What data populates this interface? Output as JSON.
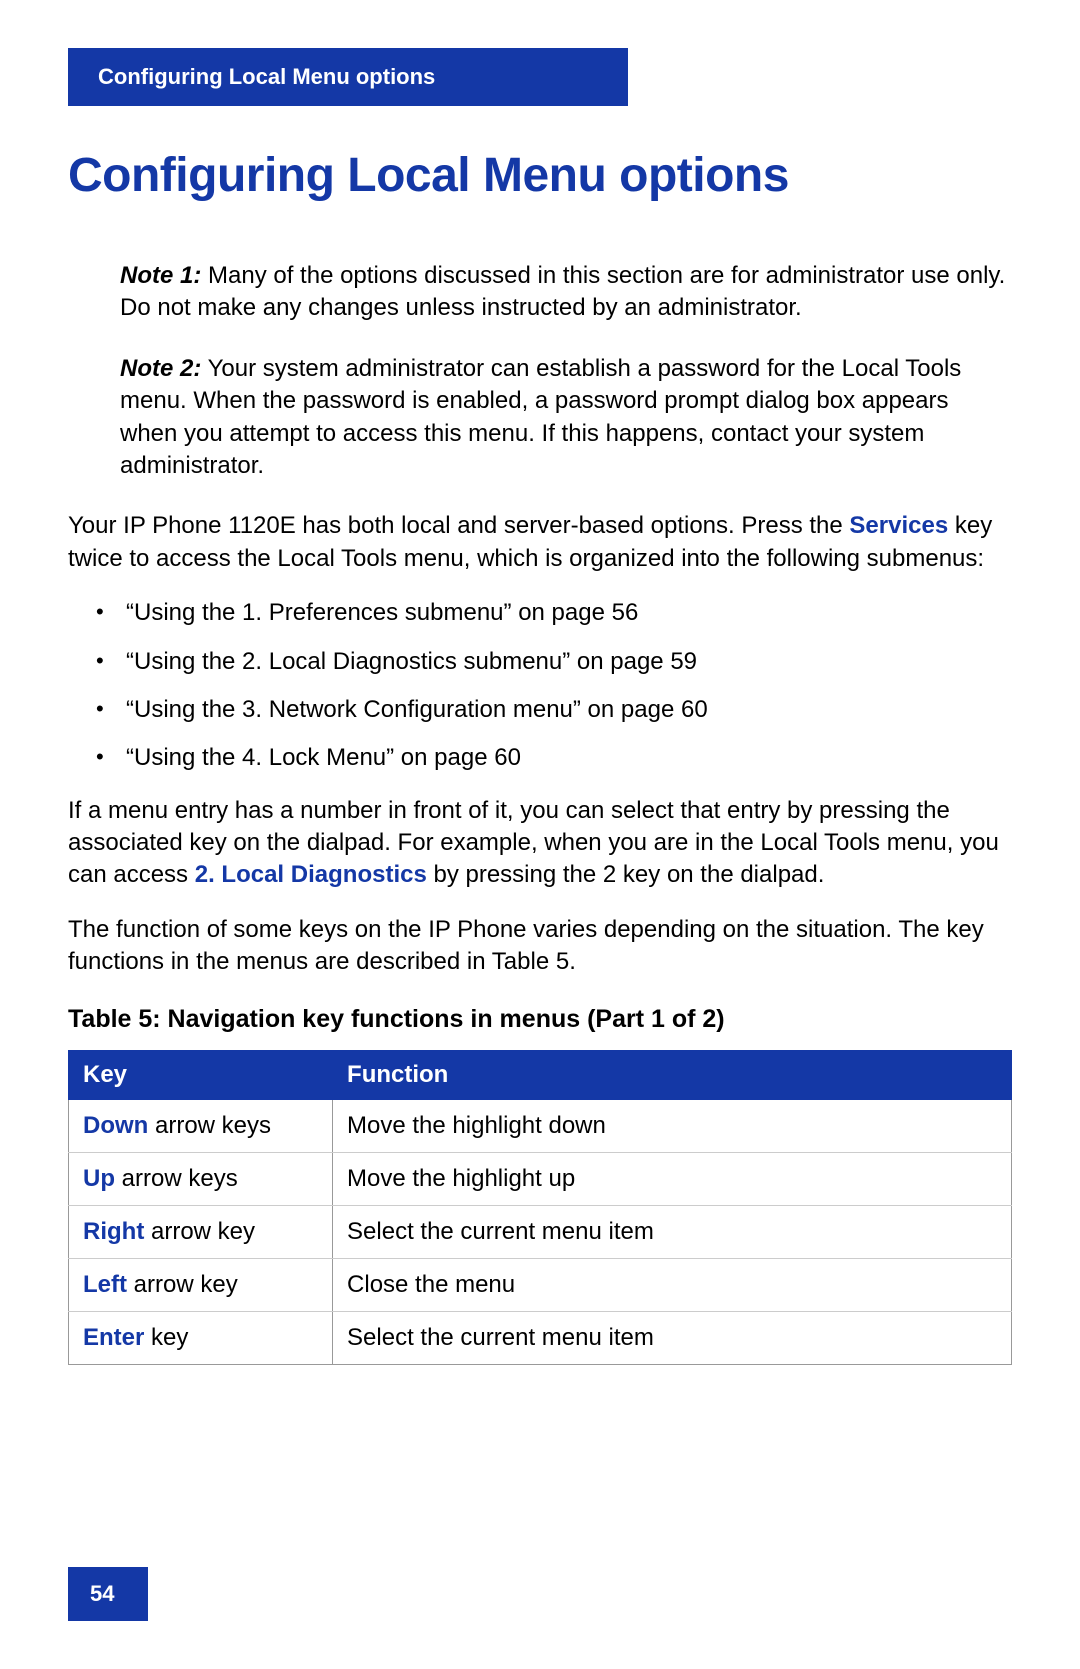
{
  "header": {
    "tab_title": "Configuring Local Menu options"
  },
  "page_title": "Configuring Local Menu options",
  "notes": {
    "note1_label": "Note 1:",
    "note1_text": " Many of the options discussed in this section are for administrator use only. Do not make any changes unless instructed by an administrator.",
    "note2_label": "Note 2:",
    "note2_text": " Your system administrator can establish a password for the Local Tools menu. When the password is enabled, a password prompt dialog box appears when you attempt to access this menu. If this happens, contact your system administrator."
  },
  "intro": {
    "pre": "Your IP Phone 1120E has both local and server-based options. Press the ",
    "services_label": "Services",
    "post": " key twice to access the Local Tools menu, which is organized into the following submenus:"
  },
  "bullets": [
    "“Using the 1. Preferences submenu” on page 56",
    "“Using the 2. Local Diagnostics submenu” on page 59",
    "“Using the 3. Network Configuration menu” on page 60",
    "“Using the 4. Lock Menu” on page 60"
  ],
  "after_bullets": {
    "pre": "If a menu entry has a number in front of it, you can select that entry by pressing the associated key on the dialpad. For example, when you are in the Local Tools menu, you can access ",
    "bold": "2. Local Diagnostics",
    "post": " by pressing the 2 key on the dialpad."
  },
  "func_paragraph": "The function of some keys on the IP Phone varies depending on the situation. The key functions in the menus are described in Table 5.",
  "table": {
    "title": "Table 5: Navigation key functions in menus (Part 1 of 2)",
    "headers": {
      "key": "Key",
      "function": "Function"
    },
    "rows": [
      {
        "key_bold": "Down",
        "key_rest": " arrow keys",
        "function": "Move the highlight down"
      },
      {
        "key_bold": "Up",
        "key_rest": " arrow keys",
        "function": "Move the highlight up"
      },
      {
        "key_bold": "Right",
        "key_rest": " arrow key",
        "function": "Select the current menu item"
      },
      {
        "key_bold": "Left",
        "key_rest": " arrow key",
        "function": "Close the menu"
      },
      {
        "key_bold": "Enter",
        "key_rest": " key",
        "function": "Select the current menu item"
      }
    ]
  },
  "page_number": "54"
}
